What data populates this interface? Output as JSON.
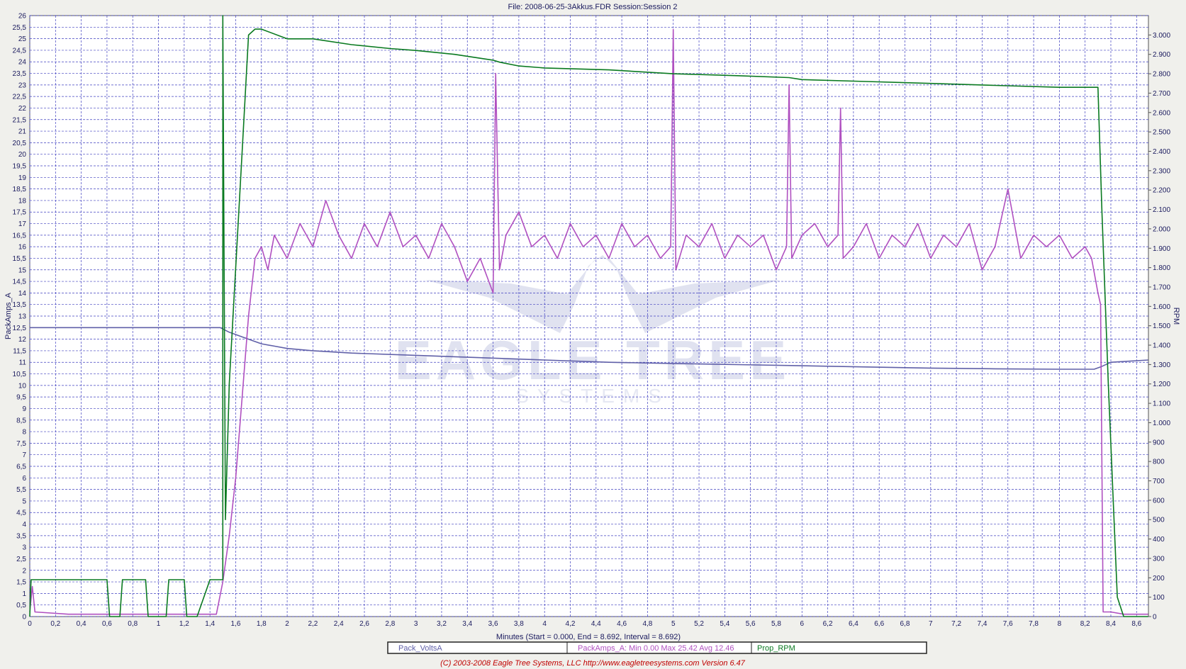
{
  "header": {
    "title": "File: 2008-06-25-3Akkus.FDR   Session:Session 2"
  },
  "footer": {
    "copyright": "(C) 2003-2008 Eagle Tree Systems, LLC      http://www.eagletreesystems.com     Version 6.47"
  },
  "watermark": {
    "line1": "EAGLE TREE",
    "line2": "SYSTEMS"
  },
  "colors": {
    "background": "#f0f0ec",
    "plot_bg": "#ffffff",
    "grid": "#4040c0",
    "axis_text": "#1a1a5e",
    "volts": "#6060a8",
    "amps": "#b050c0",
    "rpm": "#0a7a20",
    "footer_text": "#c00000",
    "watermark": "#c8cce4"
  },
  "legend": {
    "volts": "Pack_VoltsA",
    "amps": "PackAmps_A:  Min 0.00   Max 25.42   Avg 12.46",
    "rpm": "Prop_RPM"
  },
  "chart_data": {
    "type": "line",
    "xlabel": "Minutes (Start = 0.000,  End = 8.692,  Interval = 8.692)",
    "ylabel_left": "PackAmps_A",
    "ylabel_right": "RPM",
    "xlim": [
      0,
      8.692
    ],
    "ylim_left": [
      0,
      26
    ],
    "ylim_right": [
      0,
      3100
    ],
    "x_ticks": [
      "0",
      "0,2",
      "0,4",
      "0,6",
      "0,8",
      "1",
      "1,2",
      "1,4",
      "1,6",
      "1,8",
      "2",
      "2,2",
      "2,4",
      "2,6",
      "2,8",
      "3",
      "3,2",
      "3,4",
      "3,6",
      "3,8",
      "4",
      "4,2",
      "4,4",
      "4,6",
      "4,8",
      "5",
      "5,2",
      "5,4",
      "5,6",
      "5,8",
      "6",
      "6,2",
      "6,4",
      "6,6",
      "6,8",
      "7",
      "7,2",
      "7,4",
      "7,6",
      "7,8",
      "8",
      "8,2",
      "8,4",
      "8,6"
    ],
    "y_left_ticks": [
      "0",
      "0,5",
      "1",
      "1,5",
      "2",
      "2,5",
      "3",
      "3,5",
      "4",
      "4,5",
      "5",
      "5,5",
      "6",
      "6,5",
      "7",
      "7,5",
      "8",
      "8,5",
      "9",
      "9,5",
      "10",
      "10,5",
      "11",
      "11,5",
      "12",
      "12,5",
      "13",
      "13,5",
      "14",
      "14,5",
      "15",
      "15,5",
      "16",
      "16,5",
      "17",
      "17,5",
      "18",
      "18,5",
      "19",
      "19,5",
      "20",
      "20,5",
      "21",
      "21,5",
      "22",
      "22,5",
      "23",
      "23,5",
      "24",
      "24,5",
      "25",
      "25,5",
      "26"
    ],
    "y_right_ticks": [
      "0",
      "100",
      "200",
      "300",
      "400",
      "500",
      "600",
      "700",
      "800",
      "900",
      "1.000",
      "1.100",
      "1.200",
      "1.300",
      "1.400",
      "1.500",
      "1.600",
      "1.700",
      "1.800",
      "1.900",
      "2.000",
      "2.100",
      "2.200",
      "2.300",
      "2.400",
      "2.500",
      "2.600",
      "2.700",
      "2.800",
      "2.900",
      "3.000"
    ],
    "grid": true,
    "legend_position": "bottom",
    "series": [
      {
        "name": "Pack_VoltsA",
        "axis": "left",
        "x": [
          0,
          1.48,
          1.55,
          1.65,
          1.75,
          1.8,
          1.9,
          2.0,
          2.2,
          2.5,
          3.0,
          3.5,
          4.0,
          4.5,
          5.0,
          5.5,
          6.0,
          6.5,
          7.0,
          7.5,
          8.0,
          8.27,
          8.32,
          8.4,
          8.69
        ],
        "y": [
          12.5,
          12.5,
          12.3,
          12.1,
          11.9,
          11.8,
          11.7,
          11.6,
          11.5,
          11.4,
          11.3,
          11.2,
          11.1,
          11.0,
          10.95,
          10.9,
          10.85,
          10.8,
          10.75,
          10.72,
          10.7,
          10.7,
          10.8,
          11.0,
          11.1
        ]
      },
      {
        "name": "PackAmps_A",
        "axis": "left",
        "x": [
          0,
          0.02,
          0.04,
          0.3,
          0.6,
          0.8,
          1.0,
          1.2,
          1.45,
          1.5,
          1.55,
          1.6,
          1.65,
          1.7,
          1.75,
          1.8,
          1.85,
          1.9,
          2.0,
          2.1,
          2.2,
          2.3,
          2.4,
          2.5,
          2.6,
          2.7,
          2.8,
          2.9,
          3.0,
          3.1,
          3.2,
          3.3,
          3.4,
          3.5,
          3.6,
          3.62,
          3.65,
          3.7,
          3.8,
          3.9,
          4.0,
          4.1,
          4.2,
          4.3,
          4.4,
          4.5,
          4.6,
          4.7,
          4.8,
          4.9,
          4.98,
          5.0,
          5.02,
          5.1,
          5.2,
          5.3,
          5.4,
          5.5,
          5.6,
          5.7,
          5.8,
          5.88,
          5.9,
          5.92,
          6.0,
          6.1,
          6.2,
          6.28,
          6.3,
          6.32,
          6.4,
          6.5,
          6.6,
          6.7,
          6.8,
          6.9,
          7.0,
          7.1,
          7.2,
          7.3,
          7.4,
          7.5,
          7.6,
          7.7,
          7.8,
          7.9,
          8.0,
          8.1,
          8.2,
          8.25,
          8.3,
          8.32,
          8.34,
          8.4,
          8.5,
          8.69
        ],
        "y": [
          0.2,
          1.3,
          0.2,
          0.1,
          0.1,
          0.1,
          0.1,
          0.1,
          0.1,
          1.5,
          3.5,
          6.0,
          9.5,
          13.0,
          15.5,
          16.0,
          15.0,
          16.5,
          15.5,
          17.0,
          16.0,
          18.0,
          16.5,
          15.5,
          17.0,
          16.0,
          17.5,
          16.0,
          16.5,
          15.5,
          17.0,
          16.0,
          14.5,
          15.5,
          14.0,
          23.5,
          15.0,
          16.5,
          17.5,
          16.0,
          16.5,
          15.5,
          17.0,
          16.0,
          16.5,
          15.5,
          17.0,
          16.0,
          16.5,
          15.5,
          16.0,
          25.4,
          15.0,
          16.5,
          16.0,
          17.0,
          15.5,
          16.5,
          16.0,
          16.5,
          15.0,
          16.0,
          23.0,
          15.5,
          16.5,
          17.0,
          16.0,
          16.5,
          22.0,
          15.5,
          16.0,
          17.0,
          15.5,
          16.5,
          16.0,
          17.0,
          15.5,
          16.5,
          16.0,
          17.0,
          15.0,
          16.0,
          18.5,
          15.5,
          16.5,
          16.0,
          16.5,
          15.5,
          16.0,
          15.5,
          14.0,
          13.5,
          0.2,
          0.2,
          0.1,
          0.1
        ]
      },
      {
        "name": "Prop_RPM",
        "axis": "right",
        "x": [
          0,
          0.01,
          0.02,
          0.6,
          0.62,
          0.7,
          0.72,
          0.8,
          0.9,
          0.92,
          1.06,
          1.08,
          1.1,
          1.2,
          1.22,
          1.3,
          1.4,
          1.42,
          1.5,
          1.5,
          1.52,
          1.55,
          1.6,
          1.65,
          1.7,
          1.75,
          1.8,
          2.0,
          2.2,
          2.5,
          2.8,
          3.0,
          3.3,
          3.5,
          3.6,
          3.65,
          3.8,
          4.0,
          4.5,
          5.0,
          5.5,
          5.9,
          6.0,
          6.5,
          7.0,
          7.5,
          8.0,
          8.3,
          8.33,
          8.38,
          8.45,
          8.5,
          8.69
        ],
        "y": [
          0,
          190,
          190,
          190,
          0,
          0,
          190,
          190,
          190,
          0,
          0,
          190,
          190,
          190,
          0,
          0,
          190,
          190,
          190,
          3100,
          500,
          1200,
          1800,
          2400,
          3000,
          3030,
          3030,
          2980,
          2980,
          2950,
          2930,
          2920,
          2900,
          2880,
          2870,
          2860,
          2840,
          2830,
          2820,
          2800,
          2790,
          2780,
          2770,
          2760,
          2750,
          2740,
          2730,
          2730,
          2100,
          1200,
          100,
          0,
          0
        ]
      }
    ]
  }
}
